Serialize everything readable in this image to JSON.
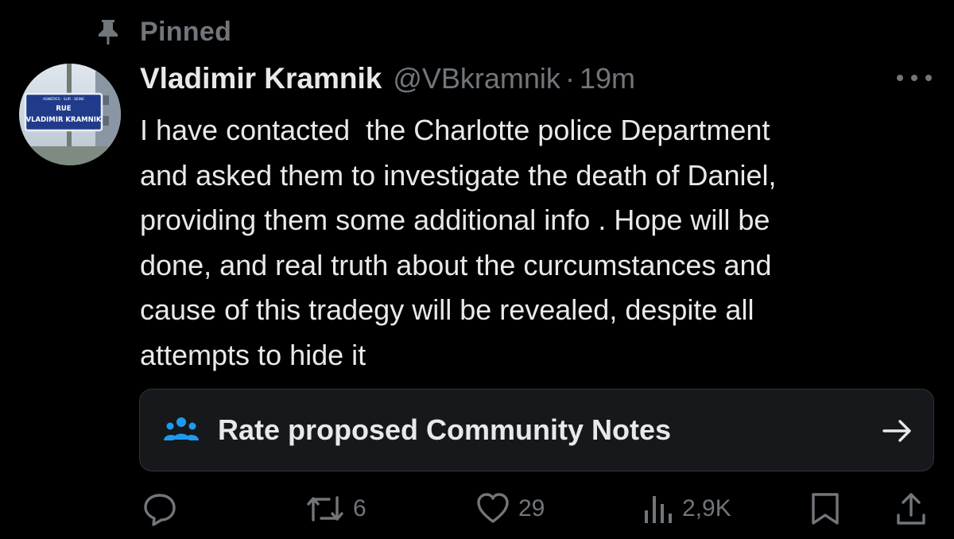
{
  "pinned_label": "Pinned",
  "author": {
    "display_name": "Vladimir Kramnik",
    "handle": "@VBkramnik",
    "separator": "·",
    "time": "19m",
    "avatar_sign": {
      "top_line": "ASNIÈRES · SUR · SEINE",
      "line1": "RUE",
      "line2": "VLADIMIR KRAMNIK"
    }
  },
  "tweet_text": "I have contacted  the Charlotte police Department\nand asked them to investigate the death of Daniel,\nproviding them some additional info . Hope will be\ndone, and real truth about the curcumstances and\ncause of this tradegy will be revealed, despite all\nattempts to hide it",
  "community_notes": {
    "label": "Rate proposed Community Notes",
    "icon": "people-icon",
    "arrow": "arrow-right-icon"
  },
  "actions": {
    "reply": {
      "icon": "reply-icon",
      "count": ""
    },
    "repost": {
      "icon": "repost-icon",
      "count": "6"
    },
    "like": {
      "icon": "heart-icon",
      "count": "29"
    },
    "views": {
      "icon": "views-icon",
      "count": "2,9K"
    },
    "bookmark": {
      "icon": "bookmark-icon"
    },
    "share": {
      "icon": "share-icon"
    }
  },
  "colors": {
    "background": "#000000",
    "text_primary": "#e7e9ea",
    "text_secondary": "#71767b",
    "card_background": "#16181c",
    "accent_blue": "#1d9bf0"
  }
}
